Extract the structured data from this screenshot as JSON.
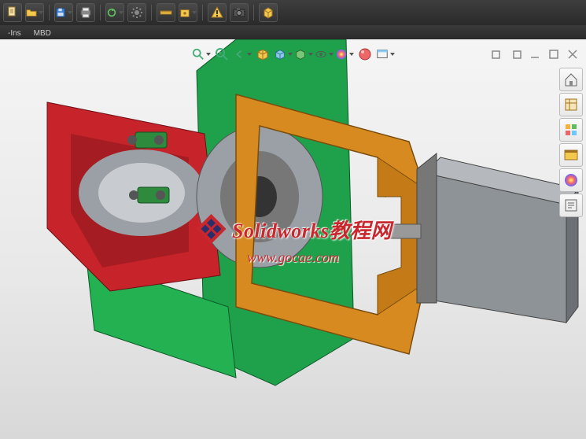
{
  "tabs": {
    "ins": "-Ins",
    "mbd": "MBD"
  },
  "watermark": {
    "title": "Solidworks教程网",
    "url": "www.gocae.com"
  }
}
